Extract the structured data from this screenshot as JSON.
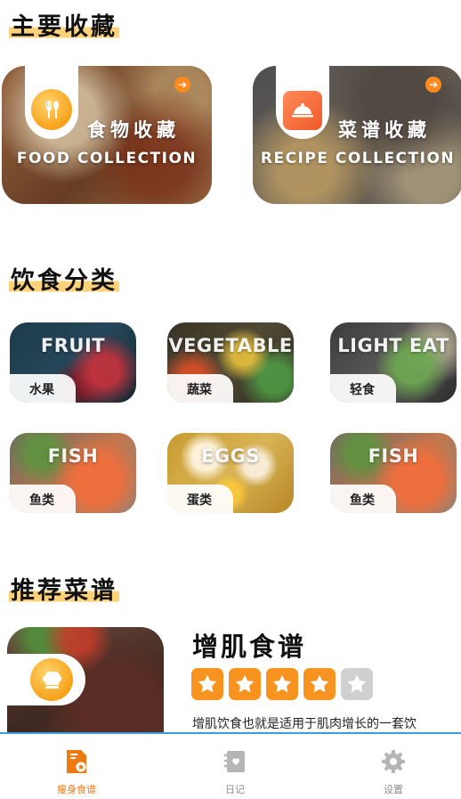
{
  "sections": {
    "main_collections": "主要收藏",
    "diet_categories": "饮食分类",
    "recommended_recipes": "推荐菜谱"
  },
  "collections": [
    {
      "title": "食物收藏",
      "subtitle": "FOOD COLLECTION",
      "icon": "fork-spoon-icon"
    },
    {
      "title": "菜谱收藏",
      "subtitle": "RECIPE  COLLECTION",
      "icon": "serving-dish-icon"
    }
  ],
  "categories": [
    {
      "en": "FRUIT",
      "zh": "水果"
    },
    {
      "en": "VEGETABLE",
      "zh": "蔬菜"
    },
    {
      "en": "LIGHT EAT",
      "zh": "轻食"
    },
    {
      "en": "FISH",
      "zh": "鱼类"
    },
    {
      "en": "EGGS",
      "zh": "蛋类"
    },
    {
      "en": "FISH",
      "zh": "鱼类"
    }
  ],
  "recommended": {
    "title": "增肌食谱",
    "rating": 4,
    "rating_max": 5,
    "description": "增肌饮食也就是适用于肌肉增长的一套饮"
  },
  "tabbar": [
    {
      "label": "瘦身食谱",
      "icon": "recipe-book-icon",
      "active": true
    },
    {
      "label": "日记",
      "icon": "diary-icon",
      "active": false
    },
    {
      "label": "设置",
      "icon": "gear-icon",
      "active": false
    }
  ],
  "colors": {
    "accent": "#f7931e",
    "highlight": "#ffd27a",
    "tab_active": "#f07a12",
    "tab_border": "#3d9be0"
  }
}
